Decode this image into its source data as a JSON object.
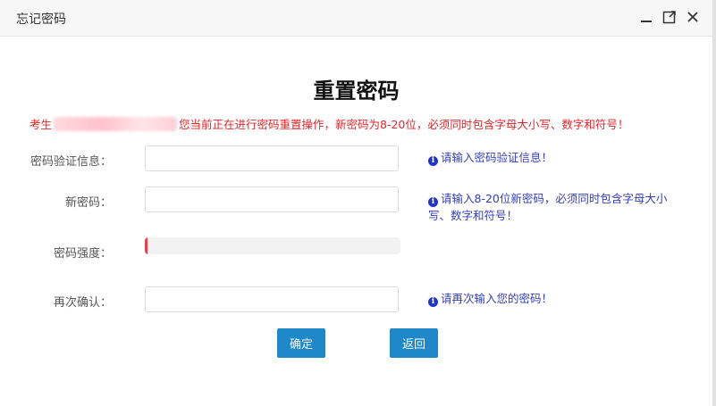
{
  "window": {
    "title": "忘记密码"
  },
  "heading": "重置密码",
  "notice": {
    "prefix": "考生",
    "message": "您当前正在进行密码重置操作，新密码为8-20位，必须同时包含字母大小写、数字和符号！"
  },
  "form": {
    "verify": {
      "label": "密码验证信息：",
      "value": "",
      "hint": "请输入密码验证信息！"
    },
    "new_password": {
      "label": "新密码：",
      "value": "",
      "hint": "请输入8-20位新密码，必须同时包含字母大小写、数字和符号！"
    },
    "strength": {
      "label": "密码强度：",
      "level_percent": 1
    },
    "confirm": {
      "label": "再次确认：",
      "value": "",
      "hint": "请再次输入您的密码！"
    }
  },
  "buttons": {
    "ok": "确定",
    "back": "返回"
  },
  "colors": {
    "notice": "#e0262a",
    "hint": "#3540b8",
    "button": "#1e88c8",
    "strength": "#e8414a"
  },
  "icons": [
    "minimize-icon",
    "maximize-icon",
    "close-icon",
    "info-icon"
  ]
}
